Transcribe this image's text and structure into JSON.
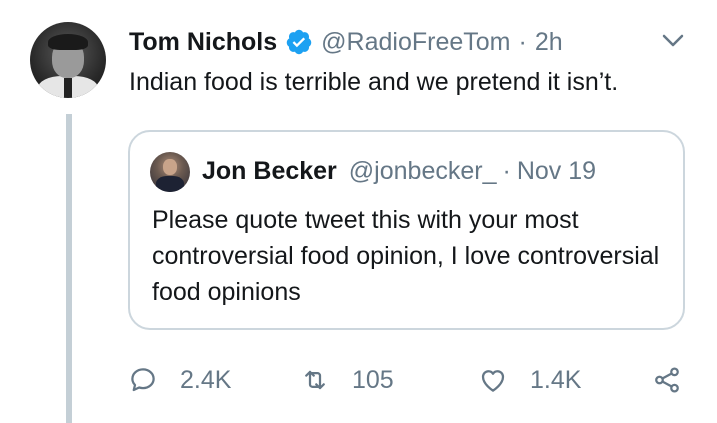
{
  "tweet": {
    "author_name": "Tom Nichols",
    "author_handle": "@RadioFreeTom",
    "separator": "·",
    "time": "2h",
    "text": "Indian food is terrible and we pretend it isn’t.",
    "verified_icon": "verified-badge-icon",
    "menu_icon": "chevron-down-icon",
    "accent_color": "#1da1f2"
  },
  "quote": {
    "author_name": "Jon Becker",
    "author_handle": "@jonbecker_",
    "separator": "·",
    "time": "Nov 19",
    "text": "Please quote tweet this with your most controversial food opinion, I love controversial food opinions"
  },
  "actions": {
    "reply": {
      "icon": "reply-icon",
      "count": "2.4K"
    },
    "retweet": {
      "icon": "retweet-icon",
      "count": "105"
    },
    "like": {
      "icon": "heart-icon",
      "count": "1.4K"
    },
    "share": {
      "icon": "share-icon"
    }
  }
}
